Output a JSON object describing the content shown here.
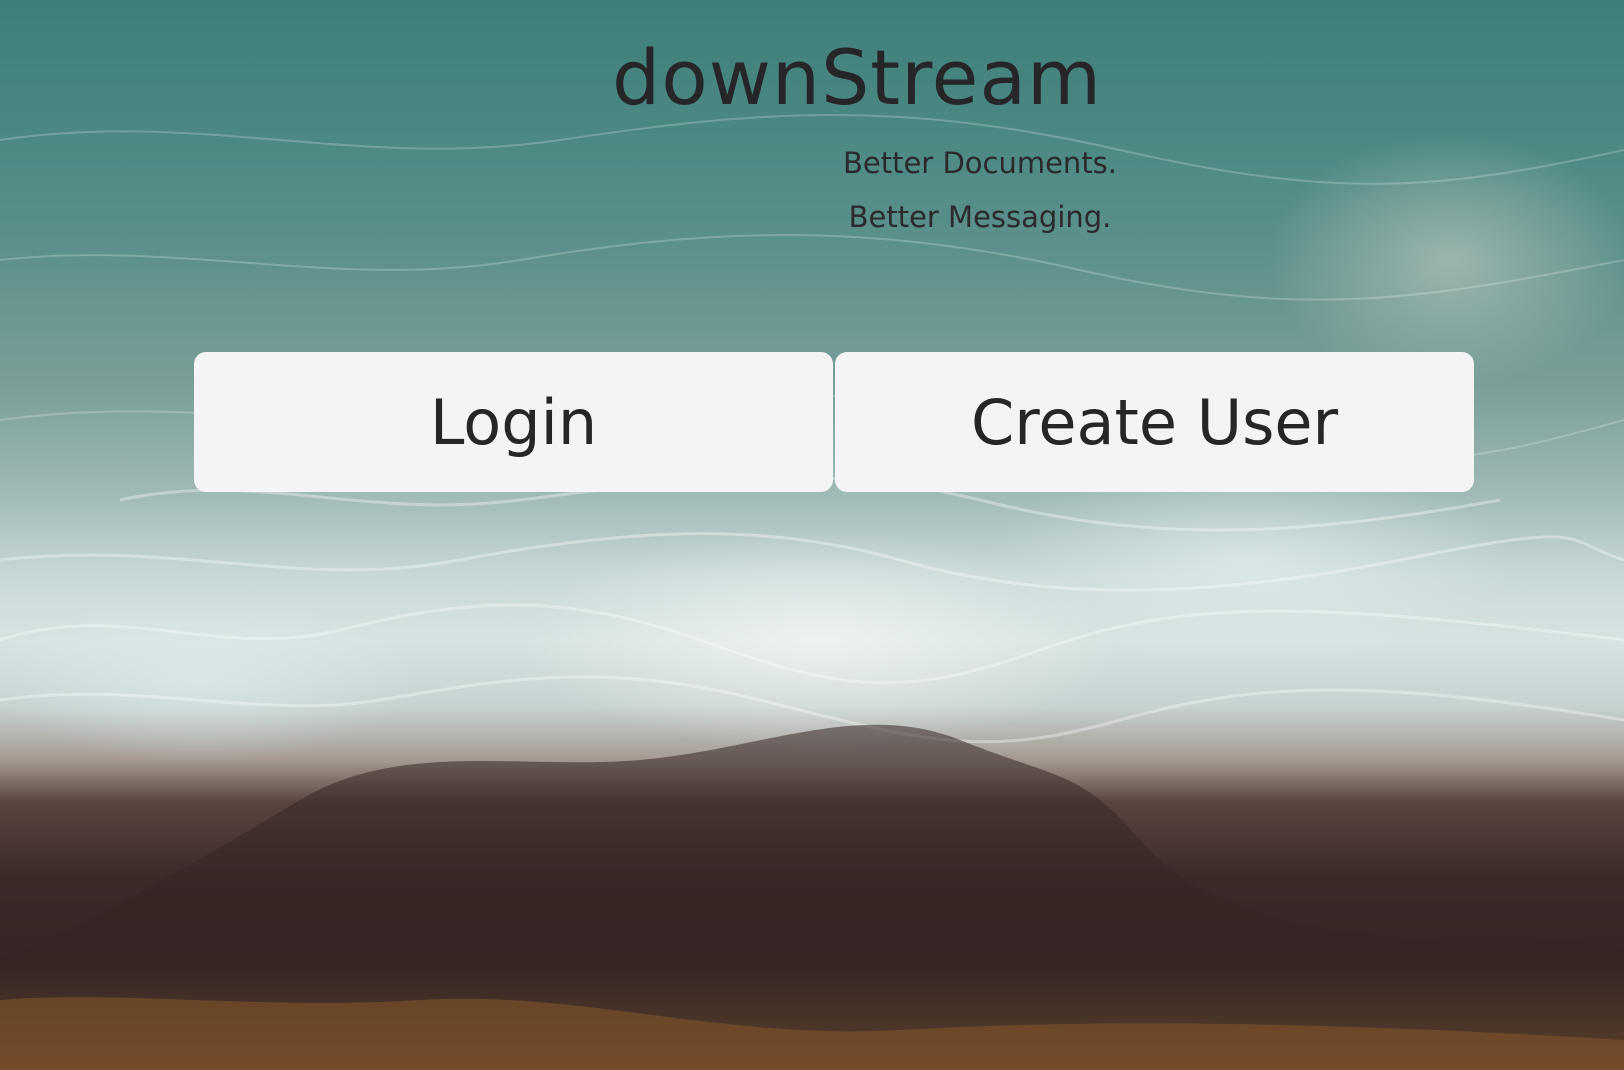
{
  "app": {
    "title": "downStream",
    "tagline_1": "Better Documents.",
    "tagline_2": "Better Messaging."
  },
  "actions": {
    "login_label": "Login",
    "create_user_label": "Create User"
  },
  "colors": {
    "text": "#262628",
    "button_bg": "#f4f4f4"
  }
}
